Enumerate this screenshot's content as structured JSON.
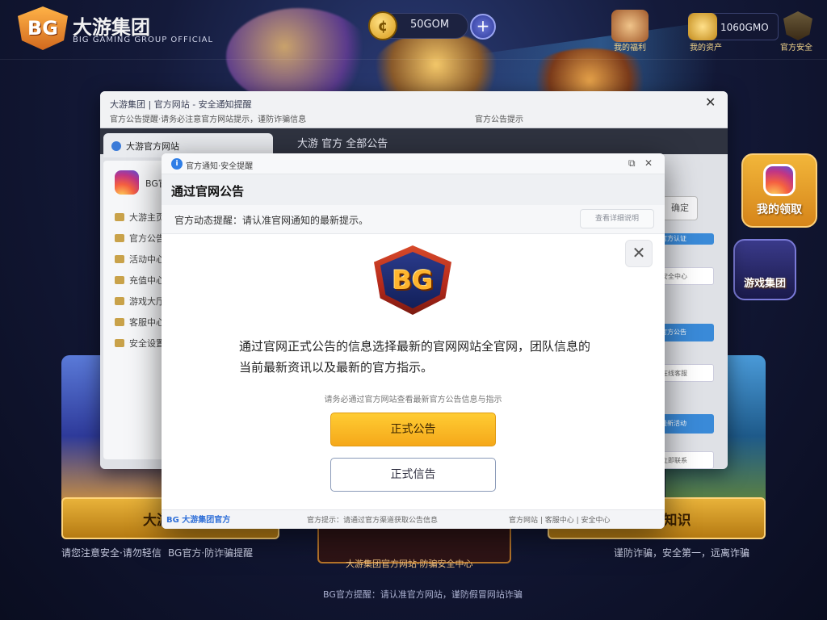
{
  "app": {
    "brand_short": "BG",
    "brand_title": "大游集团",
    "brand_subtitle": "BIG GAMING GROUP OFFICIAL",
    "coin_symbol": "¢",
    "coin_balance": "50GOM",
    "plus_symbol": "+",
    "top_icon_1_label": "我的福利",
    "top_icon_2_label": "我的资产",
    "username": "1060GMO",
    "shield_label": "官方安全"
  },
  "background_window": {
    "title": "大游集团 | 官方网站 - 安全通知提醒",
    "title_line2": "官方公告提醒·请务必注意官方网站提示，谨防诈骗信息",
    "title_right": "官方公告提示",
    "close_symbol": "✕",
    "tab_active": "大游官方网站",
    "tab_2": "大游 官方 全部公告",
    "sidebar_brand": "BG官方",
    "sidebar_items": [
      "大游主页",
      "官方公告",
      "活动中心",
      "充值中心",
      "游戏大厅",
      "客服中心",
      "安全设置"
    ],
    "right_chips": [
      "官方认证",
      "安全中心",
      "官方公告",
      "在线客服",
      "最新活动",
      "立即联系"
    ],
    "ghost_button": "确定"
  },
  "side_cards": {
    "card_1_label": "我的领取",
    "card_2_label": "游戏集团"
  },
  "promo": {
    "left_bar": "大游防骗",
    "right_bar": "防诈骗知识",
    "bottom_left": "请您注意安全·请勿轻信",
    "bottom_mid": "BG官方·防诈骗提醒",
    "bottom_right": "谨防诈骗，安全第一，远离诈骗",
    "center_frame": "大游集团官方网站·防骗安全中心",
    "footer": "BG官方提醒：请认准官方网站，谨防假冒网站诈骗"
  },
  "dialog": {
    "app_title": "官方通知·安全提醒",
    "tb_icon_1": "⧉",
    "tb_icon_2": "✕",
    "heading": "通过官网公告",
    "subtitle": "官方动态提醒：请认准官网通知的最新提示。",
    "sub_button": "查看详细说明",
    "close_symbol": "✕",
    "logo_text": "BG",
    "body_text": "通过官网正式公告的信息选择最新的官网网站全官网，团队信息的当前最新资讯以及最新的官方指示。",
    "hint": "请务必通过官方网站查看最新官方公告信息与指示",
    "primary_button": "正式公告",
    "secondary_button": "正式信告",
    "footer_brand": "BG 大游集团官方",
    "footer_mid": "官方提示：请通过官方渠道获取公告信息",
    "footer_right": "官方网站 | 客服中心 | 安全中心"
  }
}
